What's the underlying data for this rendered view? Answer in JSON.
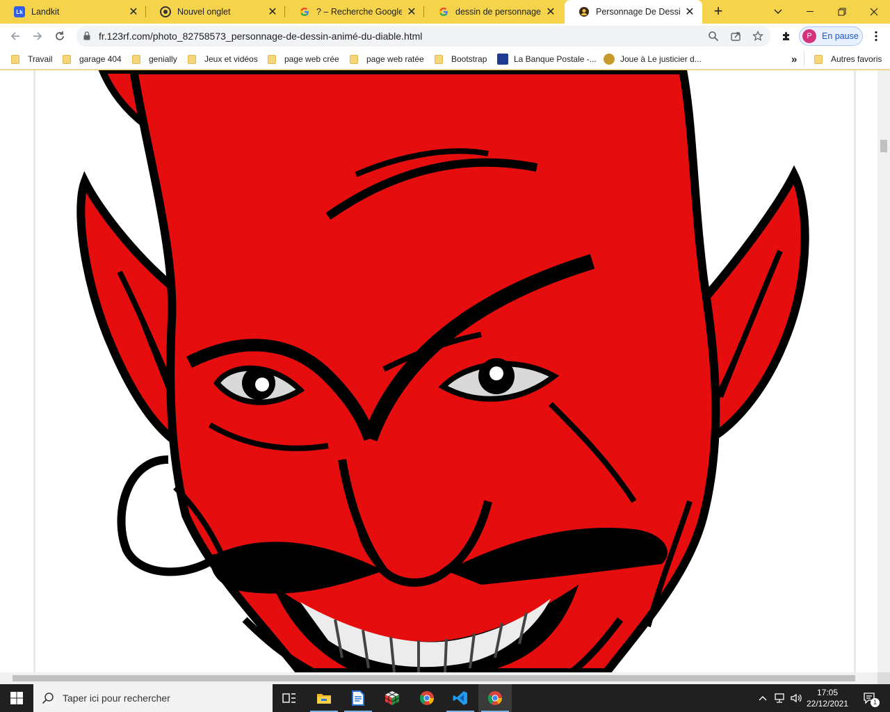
{
  "browser": {
    "tabs": [
      {
        "title": "Landkit",
        "favicon": "landkit-icon",
        "active": false
      },
      {
        "title": "Nouvel onglet",
        "favicon": "chrome-icon",
        "active": false
      },
      {
        "title": "? – Recherche Google",
        "favicon": "google-icon",
        "active": false
      },
      {
        "title": "dessin de personnage diable",
        "favicon": "google-icon",
        "active": false
      },
      {
        "title": "Personnage De Dessin Animé",
        "favicon": "123rf-icon",
        "active": true
      }
    ],
    "url": "fr.123rf.com/photo_82758573_personnage-de-dessin-animé-du-diable.html",
    "profile": {
      "initial": "P",
      "status": "En pause"
    },
    "accent_color": "#f5d34a"
  },
  "bookmarks": [
    {
      "label": "Travail",
      "icon": "folder-icon"
    },
    {
      "label": "garage 404",
      "icon": "folder-icon"
    },
    {
      "label": "genially",
      "icon": "folder-icon"
    },
    {
      "label": "Jeux et vidéos",
      "icon": "folder-icon"
    },
    {
      "label": "page web crée",
      "icon": "folder-icon"
    },
    {
      "label": "page web ratée",
      "icon": "folder-icon"
    },
    {
      "label": "Bootstrap",
      "icon": "folder-icon"
    },
    {
      "label": "La Banque Postale -...",
      "icon": "banque-postale-icon"
    },
    {
      "label": "Joue à Le justicier d...",
      "icon": "game-icon"
    }
  ],
  "bookmarks_more": "»",
  "bookmarks_other": "Autres favoris",
  "page": {
    "image": "devil-cartoon-illustration",
    "colors": {
      "skin": "#e50d0d",
      "outline": "#000000",
      "eyes": "#d9d9d9",
      "teeth": "#ececec"
    }
  },
  "taskbar": {
    "search_placeholder": "Taper ici pour rechercher",
    "time": "17:05",
    "date": "22/12/2021",
    "notifications": "1",
    "apps": [
      "task-view-icon",
      "file-explorer-icon",
      "notepad-icon",
      "rubik-cube-icon",
      "chrome-icon",
      "vscode-icon",
      "chrome-icon"
    ]
  }
}
